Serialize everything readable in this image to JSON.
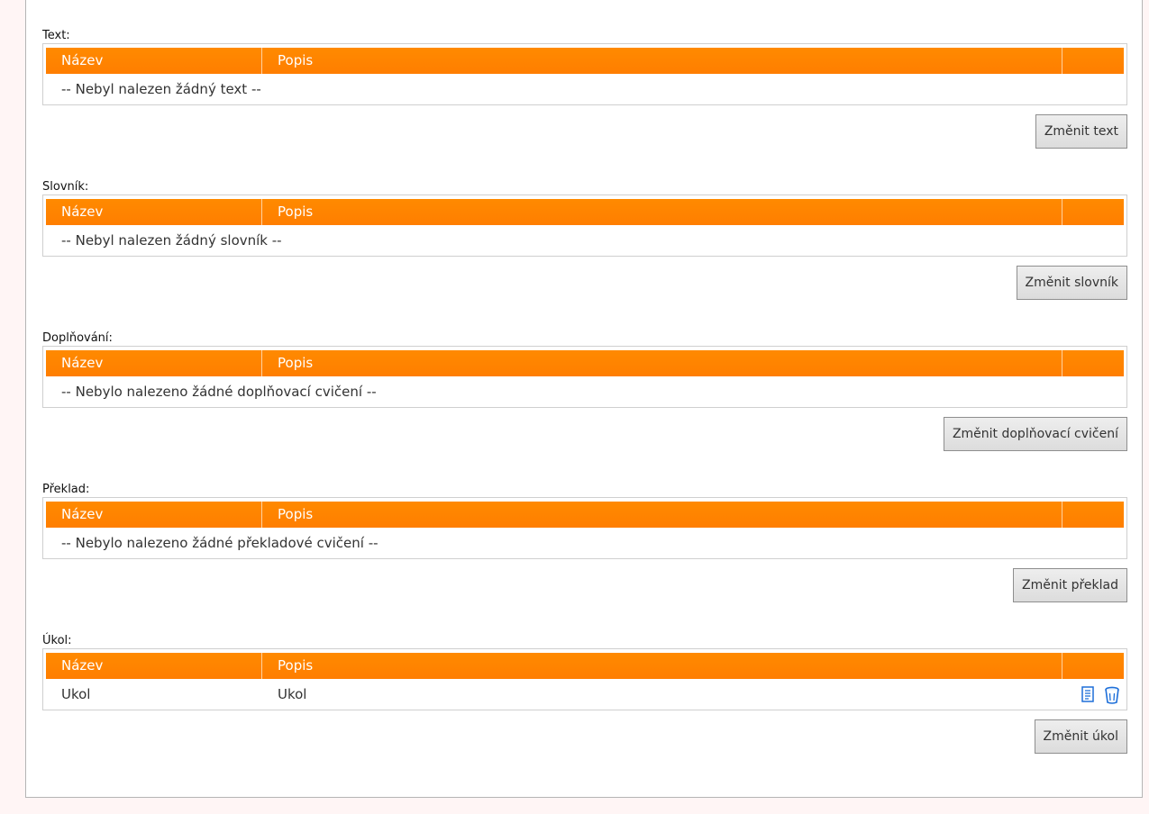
{
  "sections": [
    {
      "label": "Text:",
      "col_name": "Název",
      "col_desc": "Popis",
      "empty_message": "-- Nebyl nalezen žádný text --",
      "button_label": "Změnit text"
    },
    {
      "label": "Slovník:",
      "col_name": "Název",
      "col_desc": "Popis",
      "empty_message": "-- Nebyl nalezen žádný slovník --",
      "button_label": "Změnit slovník"
    },
    {
      "label": "Doplňování:",
      "col_name": "Název",
      "col_desc": "Popis",
      "empty_message": "-- Nebylo nalezeno žádné doplňovací cvičení --",
      "button_label": "Změnit doplňovací cvičení"
    },
    {
      "label": "Překlad:",
      "col_name": "Název",
      "col_desc": "Popis",
      "empty_message": "-- Nebylo nalezeno žádné překladové cvičení --",
      "button_label": "Změnit překlad"
    },
    {
      "label": "Úkol:",
      "col_name": "Název",
      "col_desc": "Popis",
      "rows": [
        {
          "name": "Ukol",
          "desc": "Ukol",
          "icons": [
            "document-icon",
            "trash-icon"
          ]
        }
      ],
      "button_label": "Změnit úkol"
    }
  ],
  "colors": {
    "header_bg": "#ff8000",
    "header_text": "#ffffff",
    "page_bg": "#fff5f5",
    "icon_blue": "#1e6fd9"
  }
}
